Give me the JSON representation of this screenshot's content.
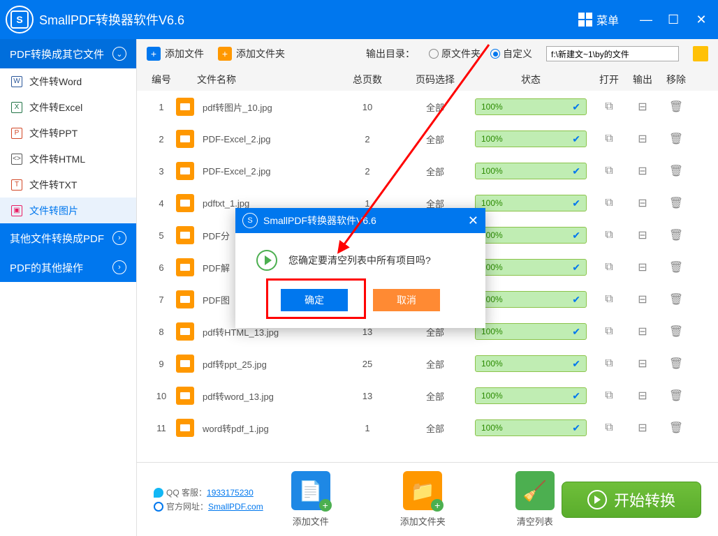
{
  "app": {
    "title": "SmallPDF转换器软件V6.6",
    "menu": "菜单"
  },
  "sidebar": {
    "cat1": "PDF转换成其它文件",
    "items": [
      {
        "label": "文件转Word",
        "icon": "W",
        "color": "#2b579a"
      },
      {
        "label": "文件转Excel",
        "icon": "X",
        "color": "#217346"
      },
      {
        "label": "文件转PPT",
        "icon": "P",
        "color": "#d24726"
      },
      {
        "label": "文件转HTML",
        "icon": "<>",
        "color": "#555"
      },
      {
        "label": "文件转TXT",
        "icon": "T",
        "color": "#d24726"
      },
      {
        "label": "文件转图片",
        "icon": "▣",
        "color": "#e91e63"
      }
    ],
    "cat2": "其他文件转换成PDF",
    "cat3": "PDF的其他操作"
  },
  "toolbar": {
    "add_file": "添加文件",
    "add_folder": "添加文件夹",
    "output_dir": "输出目录：",
    "radio_source": "原文件夹",
    "radio_custom": "自定义",
    "path": "f:\\新建文~1\\by的文件"
  },
  "columns": {
    "num": "编号",
    "name": "文件名称",
    "pages": "总页数",
    "range": "页码选择",
    "status": "状态",
    "open": "打开",
    "out": "输出",
    "del": "移除"
  },
  "rows": [
    {
      "n": "1",
      "name": "pdf转图片_10.jpg",
      "pages": "10",
      "range": "全部",
      "pct": "100%"
    },
    {
      "n": "2",
      "name": "PDF-Excel_2.jpg",
      "pages": "2",
      "range": "全部",
      "pct": "100%"
    },
    {
      "n": "3",
      "name": "PDF-Excel_2.jpg",
      "pages": "2",
      "range": "全部",
      "pct": "100%"
    },
    {
      "n": "4",
      "name": "pdftxt_1.jpg",
      "pages": "1",
      "range": "全部",
      "pct": "100%"
    },
    {
      "n": "5",
      "name": "PDF分",
      "pages": "",
      "range": "",
      "pct": "100%"
    },
    {
      "n": "6",
      "name": "PDF解",
      "pages": "",
      "range": "",
      "pct": "100%"
    },
    {
      "n": "7",
      "name": "PDF图",
      "pages": "",
      "range": "",
      "pct": "100%"
    },
    {
      "n": "8",
      "name": "pdf转HTML_13.jpg",
      "pages": "13",
      "range": "全部",
      "pct": "100%"
    },
    {
      "n": "9",
      "name": "pdf转ppt_25.jpg",
      "pages": "25",
      "range": "全部",
      "pct": "100%"
    },
    {
      "n": "10",
      "name": "pdf转word_13.jpg",
      "pages": "13",
      "range": "全部",
      "pct": "100%"
    },
    {
      "n": "11",
      "name": "word转pdf_1.jpg",
      "pages": "1",
      "range": "全部",
      "pct": "100%"
    }
  ],
  "bottom": {
    "qq_label": "QQ 客服：",
    "qq": "1933175230",
    "site_label": "官方网址：",
    "site": "SmallPDF.com",
    "add_file": "添加文件",
    "add_folder": "添加文件夹",
    "clear": "清空列表",
    "start": "开始转换"
  },
  "dialog": {
    "title": "SmallPDF转换器软件V6.6",
    "msg": "您确定要清空列表中所有项目吗?",
    "ok": "确定",
    "cancel": "取消"
  }
}
